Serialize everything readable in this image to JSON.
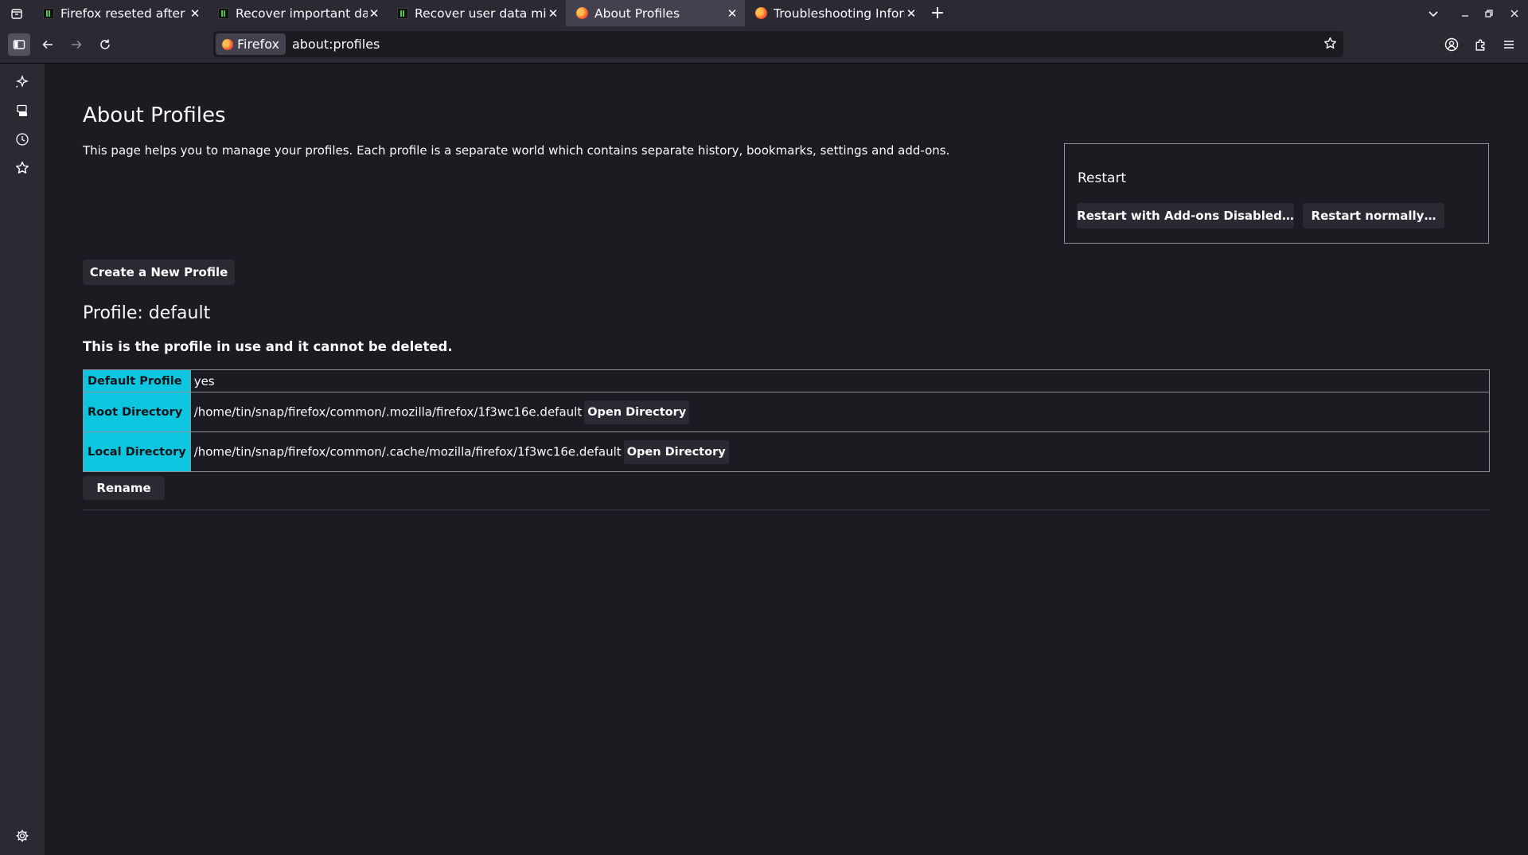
{
  "tabs": [
    {
      "title": "Firefox reseted after rebo",
      "icon": "terminal-favicon",
      "selected": false
    },
    {
      "title": "Recover important data fr",
      "icon": "terminal-favicon",
      "selected": false
    },
    {
      "title": "Recover user data missing",
      "icon": "terminal-favicon",
      "selected": false
    },
    {
      "title": "About Profiles",
      "icon": "firefox-favicon",
      "selected": true
    },
    {
      "title": "Troubleshooting Informat",
      "icon": "firefox-favicon",
      "selected": false
    }
  ],
  "urlbar": {
    "identity_label": "Firefox",
    "url": "about:profiles"
  },
  "page": {
    "title": "About Profiles",
    "intro": "This page helps you to manage your profiles. Each profile is a separate world which contains separate history, bookmarks, settings and add-ons.",
    "restart": {
      "heading": "Restart",
      "addons_disabled_label": "Restart with Add-ons Disabled…",
      "normally_label": "Restart normally…"
    },
    "create_profile_label": "Create a New Profile",
    "profile": {
      "name": "Profile: default",
      "in_use_note": "This is the profile in use and it cannot be deleted.",
      "rows": {
        "default_profile": {
          "label": "Default Profile",
          "value": "yes"
        },
        "root_directory": {
          "label": "Root Directory",
          "value": "/home/tin/snap/firefox/common/.mozilla/firefox/1f3wc16e.default",
          "button": "Open Directory"
        },
        "local_directory": {
          "label": "Local Directory",
          "value": "/home/tin/snap/firefox/common/.cache/mozilla/firefox/1f3wc16e.default",
          "button": "Open Directory"
        }
      },
      "rename_label": "Rename"
    }
  },
  "colors": {
    "chrome_bg": "#2b2a33",
    "page_bg": "#1c1b22",
    "selected_tab": "#42414d",
    "table_header_accent": "#0cc5de",
    "text": "#fbfbfe"
  }
}
